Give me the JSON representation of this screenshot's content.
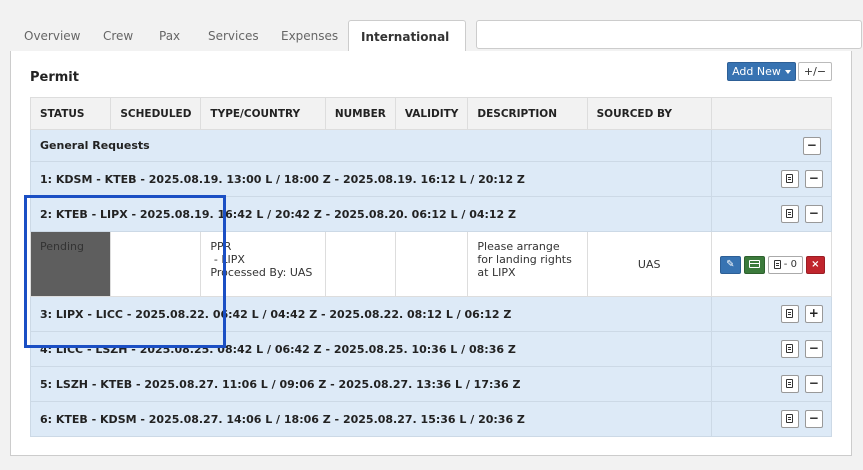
{
  "tabs": [
    {
      "label": "Overview"
    },
    {
      "label": "Crew"
    },
    {
      "label": "Pax"
    },
    {
      "label": "Services"
    },
    {
      "label": "Expenses"
    },
    {
      "label": "International"
    }
  ],
  "section": {
    "title": "Permit",
    "add_new_label": "Add New",
    "toggle_label": "+/−"
  },
  "table": {
    "headers": [
      "STATUS",
      "SCHEDULED",
      "TYPE/COUNTRY",
      "NUMBER",
      "VALIDITY",
      "DESCRIPTION",
      "SOURCED BY",
      ""
    ],
    "general_requests_label": "General Requests",
    "legs": [
      {
        "label": "1: KDSM - KTEB - 2025.08.19. 13:00 L / 18:00 Z - 2025.08.19. 16:12 L / 20:12 Z",
        "toggle": "−"
      },
      {
        "label": "2: KTEB - LIPX - 2025.08.19. 16:42 L / 20:42 Z - 2025.08.20. 06:12 L / 04:12 Z",
        "toggle": "−"
      },
      {
        "label": "3: LIPX - LICC - 2025.08.22. 06:42 L / 04:42 Z - 2025.08.22. 08:12 L / 06:12 Z",
        "toggle": "+"
      },
      {
        "label": "4: LICC - LSZH - 2025.08.25. 08:42 L / 06:42 Z - 2025.08.25. 10:36 L / 08:36 Z",
        "toggle": "−"
      },
      {
        "label": "5: LSZH - KTEB - 2025.08.27. 11:06 L / 09:06 Z - 2025.08.27. 13:36 L / 17:36 Z",
        "toggle": "−"
      },
      {
        "label": "6: KTEB - KDSM - 2025.08.27. 14:06 L / 18:06 Z - 2025.08.27. 15:36 L / 20:36 Z",
        "toggle": "−"
      }
    ],
    "permit_row": {
      "status": "Pending",
      "scheduled": "",
      "type_line1": "PPR",
      "type_line2": " - LIPX",
      "type_line3": "Processed By: UAS",
      "number": "",
      "validity": "",
      "description": "Please arrange for landing rights at LIPX",
      "sourced_by": "UAS",
      "doc_count": "0"
    }
  },
  "colors": {
    "accent": "#3773b2",
    "pending": "#5e5e5e",
    "delete": "#c0252d",
    "highlight": "#1b4fc4"
  }
}
